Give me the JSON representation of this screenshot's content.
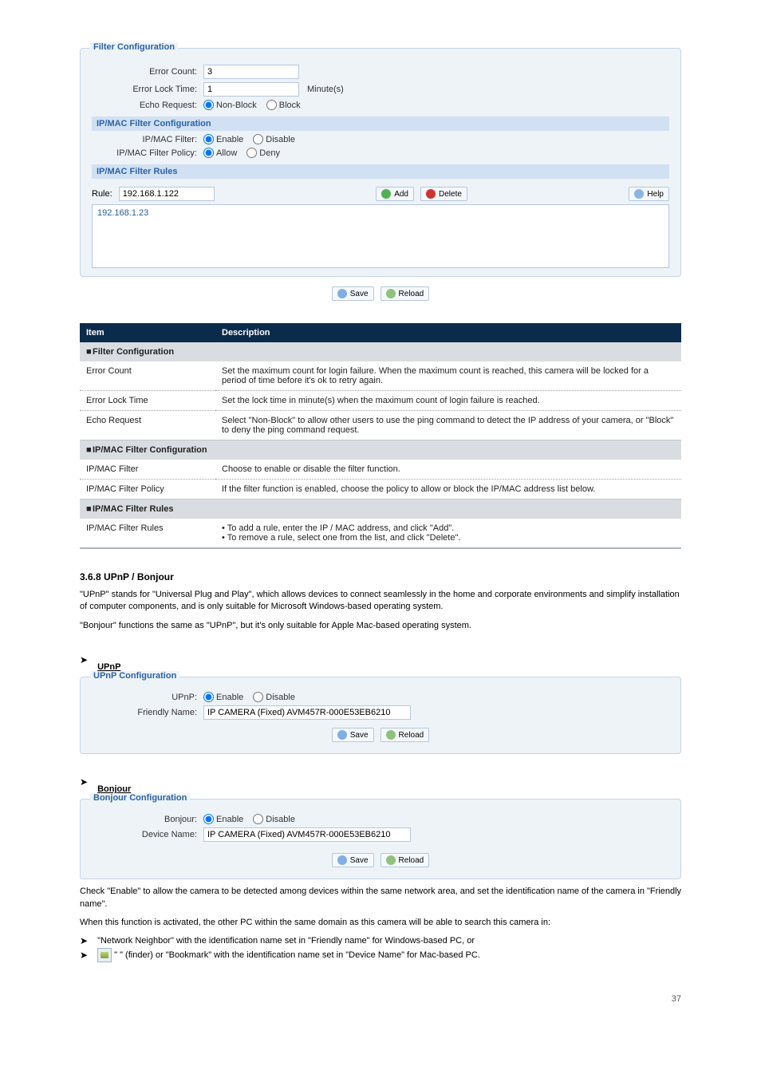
{
  "filter": {
    "title": "Filter Configuration",
    "errorCountLabel": "Error Count:",
    "errorCountValue": "3",
    "errorLockLabel": "Error Lock Time:",
    "errorLockValue": "1",
    "errorLockUnit": "Minute(s)",
    "echoLabel": "Echo Request:",
    "echoOpt1": "Non-Block",
    "echoOpt2": "Block",
    "ipmacConfTitle": "IP/MAC Filter Configuration",
    "ipmacFilterLabel": "IP/MAC Filter:",
    "enable": "Enable",
    "disable": "Disable",
    "ipmacPolicyLabel": "IP/MAC Filter Policy:",
    "allow": "Allow",
    "deny": "Deny",
    "ipmacRulesTitle": "IP/MAC Filter Rules",
    "ruleLabel": "Rule:",
    "ruleValue": "192.168.1.122",
    "addLabel": "Add",
    "deleteLabel": "Delete",
    "helpLabel": "Help",
    "listItem0": "192.168.1.23",
    "saveLabel": "Save",
    "reloadLabel": "Reload"
  },
  "def": {
    "hdrItem": "Item",
    "hdrDesc": "Description",
    "sec1": "Filter Configuration",
    "r1a": "Error Count",
    "r1b": "Set the maximum count for login failure. When the maximum count is reached, this camera will be locked for a period of time before it's ok to retry again.",
    "r2a": "Error Lock Time",
    "r2b": "Set the lock time in minute(s) when the maximum count of login failure is reached.",
    "r3a": "Echo Request",
    "r3b": "Select \"Non-Block\" to allow other users to use the ping command to detect the IP address of your camera, or \"Block\" to deny the ping command request.",
    "sec2": "IP/MAC Filter Configuration",
    "r4a": "IP/MAC Filter",
    "r4b": "Choose to enable or disable the filter function.",
    "r5a": "IP/MAC Filter Policy",
    "r5b": "If the filter function is enabled, choose the policy to allow or block the IP/MAC address list below.",
    "sec3": "IP/MAC Filter Rules",
    "r6a": "IP/MAC Filter Rules",
    "r6b1": "To add a rule, enter the IP / MAC address, and click \"Add\".",
    "r6b2": "To remove a rule, select one from the list, and click \"Delete\"."
  },
  "upnp": {
    "sectionNum": "3.6.8 UPnP / Bonjour",
    "p1": "\"UPnP\" stands for \"Universal Plug and Play\", which allows devices to connect seamlessly in the home and corporate environments and simplify installation of computer components, and is only suitable for Microsoft Windows-based operating system.",
    "p2": "\"Bonjour\" functions the same as \"UPnP\", but it's only suitable for Apple Mac-based operating system.",
    "headUpnp": "UPnP",
    "headBonjour": "Bonjour",
    "upnpPanelTitle": "UPnP Configuration",
    "upnpLabel": "UPnP:",
    "friendlyLabel": "Friendly Name:",
    "friendlyValue": "IP CAMERA (Fixed) AVM457R-000E53EB6210",
    "bonjourPanelTitle": "Bonjour Configuration",
    "bonjourLabel": "Bonjour:",
    "deviceLabel": "Device Name:",
    "deviceValue": "IP CAMERA (Fixed) AVM457R-000E53EB6210",
    "enable": "Enable",
    "disable": "Disable",
    "save": "Save",
    "reload": "Reload"
  },
  "tail": {
    "p1": "Check \"Enable\" to allow the camera to be detected among devices within the same network area, and set the identification name of the camera in \"Friendly name\".",
    "p2": "When this function is activated, the other PC within the same domain as this camera will be able to search this camera in:",
    "b1": "\"Network Neighbor\" with the identification name set in \"Friendly name\" for Windows-based PC, or",
    "b2": "\"     \" (finder) or \"Bookmark\" with the identification name set in \"Device Name\" for Mac-based PC."
  },
  "pageFooter": "37"
}
